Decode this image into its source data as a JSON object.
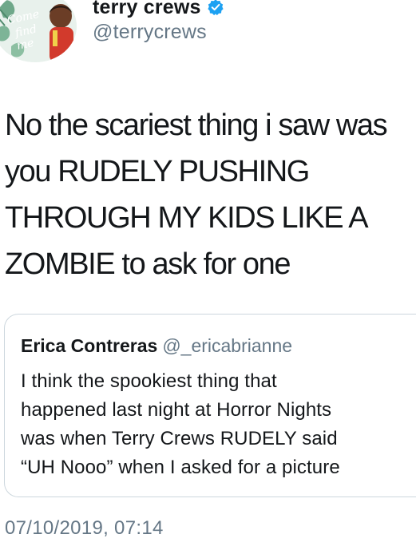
{
  "author": {
    "display_name": "terry crews",
    "handle": "@terrycrews",
    "avatar_icon": "profile-avatar-image",
    "verified_icon": "verified-badge-icon"
  },
  "tweet": {
    "text": "No the scariest thing i saw was\nyou RUDELY PUSHING\nTHROUGH MY KIDS LIKE A\nZOMBIE to ask for one"
  },
  "quoted_tweet": {
    "display_name": "Erica Contreras",
    "handle": "@_ericabrianne",
    "text": "I think the spookiest thing that\nhappened last night at Horror Nights\nwas when Terry Crews RUDELY said\n“UH Nooo” when I asked for a picture"
  },
  "timestamp": "07/10/2019, 07:14",
  "colors": {
    "primary_text": "#14171a",
    "secondary_text": "#657786",
    "verified_blue": "#1da1f2",
    "card_border": "#ccd6dd"
  }
}
